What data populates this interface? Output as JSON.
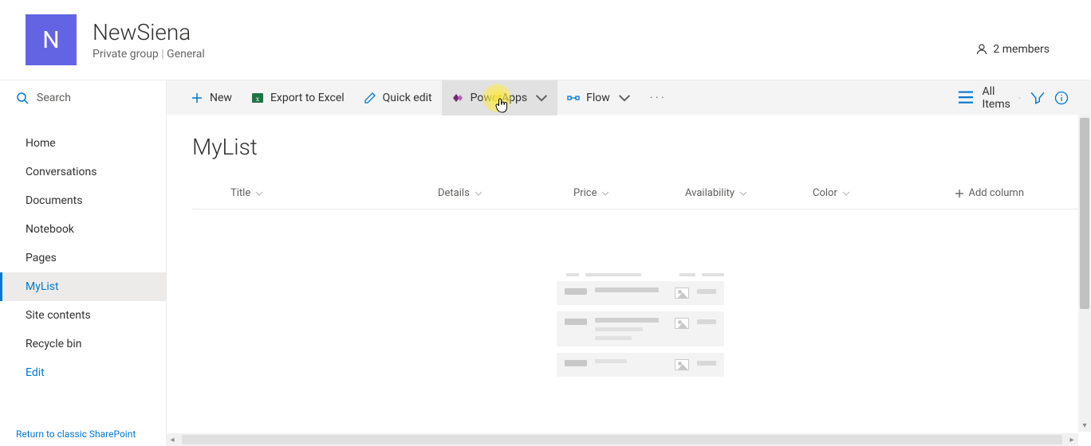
{
  "header": {
    "logo_letter": "N",
    "title": "NewSiena",
    "subtitle_left": "Private group",
    "subtitle_right": "General",
    "members_label": "2 members"
  },
  "search": {
    "placeholder": "Search"
  },
  "commands": {
    "new": "New",
    "export": "Export to Excel",
    "quickedit": "Quick edit",
    "powerapps": "PowerApps",
    "flow": "Flow",
    "allitems": "All Items"
  },
  "nav": {
    "items": [
      {
        "key": "home",
        "label": "Home"
      },
      {
        "key": "conversations",
        "label": "Conversations"
      },
      {
        "key": "documents",
        "label": "Documents"
      },
      {
        "key": "notebook",
        "label": "Notebook"
      },
      {
        "key": "pages",
        "label": "Pages"
      },
      {
        "key": "mylist",
        "label": "MyList",
        "selected": true
      },
      {
        "key": "sitecontents",
        "label": "Site contents"
      },
      {
        "key": "recyclebin",
        "label": "Recycle bin"
      },
      {
        "key": "edit",
        "label": "Edit",
        "link": true
      }
    ],
    "return_link": "Return to classic SharePoint"
  },
  "list": {
    "title": "MyList",
    "columns": {
      "title": "Title",
      "details": "Details",
      "price": "Price",
      "availability": "Availability",
      "color": "Color",
      "add": "Add column"
    }
  }
}
